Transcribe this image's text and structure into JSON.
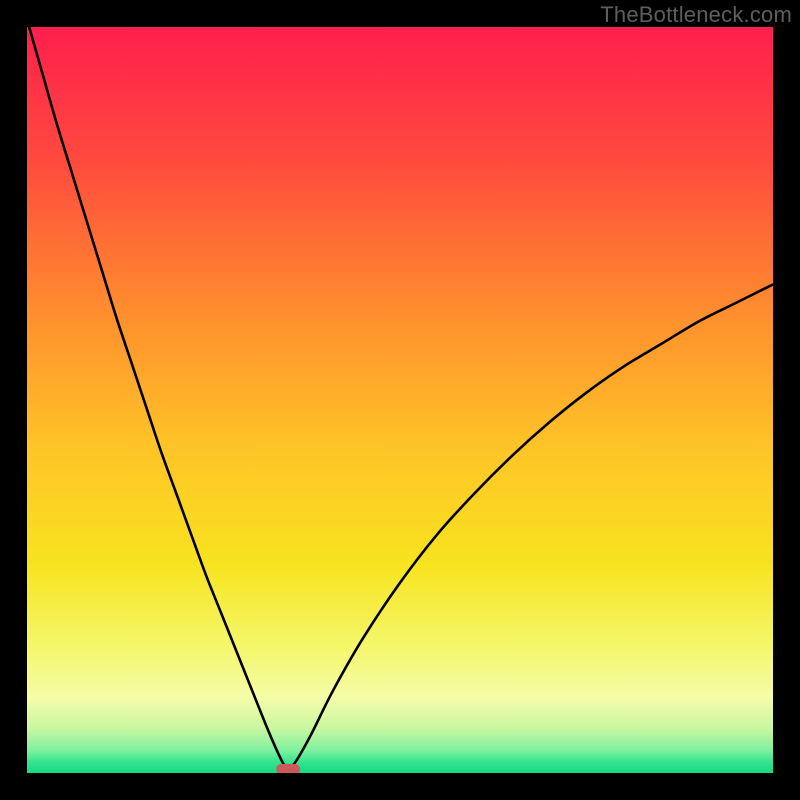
{
  "watermark": "TheBottleneck.com",
  "chart_data": {
    "type": "line",
    "title": "",
    "xlabel": "",
    "ylabel": "",
    "xlim": [
      0,
      100
    ],
    "ylim": [
      0,
      100
    ],
    "grid": false,
    "legend": false,
    "annotations": [],
    "background": {
      "type": "vertical-gradient",
      "stops": [
        {
          "pos": 0.0,
          "color": "#ff1f4d"
        },
        {
          "pos": 0.18,
          "color": "#ff4a3e"
        },
        {
          "pos": 0.38,
          "color": "#ff8d2e"
        },
        {
          "pos": 0.56,
          "color": "#ffc327"
        },
        {
          "pos": 0.72,
          "color": "#f8e31f"
        },
        {
          "pos": 0.83,
          "color": "#f4f76a"
        },
        {
          "pos": 0.9,
          "color": "#f5fca9"
        },
        {
          "pos": 0.94,
          "color": "#c9f7a0"
        },
        {
          "pos": 0.97,
          "color": "#7ef0a0"
        },
        {
          "pos": 0.985,
          "color": "#35e48f"
        },
        {
          "pos": 1.0,
          "color": "#17d983"
        }
      ]
    },
    "series": [
      {
        "name": "bottleneck-curve",
        "color": "#000000",
        "x": [
          0,
          2,
          4,
          6,
          8,
          10,
          12,
          14,
          16,
          18,
          20,
          22,
          24,
          26,
          28,
          30,
          32,
          33.5,
          34.5,
          35,
          36,
          38,
          41,
          45,
          50,
          55,
          60,
          65,
          70,
          75,
          80,
          85,
          90,
          95,
          100
        ],
        "y": [
          101,
          94,
          87,
          80.5,
          74,
          67.5,
          61,
          55,
          49,
          43,
          37.5,
          32,
          26.5,
          21.5,
          16.5,
          11.5,
          6.5,
          3,
          1,
          0.5,
          1.5,
          5,
          11,
          18,
          25.5,
          32,
          37.5,
          42.5,
          47,
          51,
          54.5,
          57.5,
          60.5,
          63,
          65.5
        ]
      }
    ],
    "marker": {
      "name": "minimum-marker",
      "x": 35,
      "y": 0.5,
      "width_pct": 3.2,
      "height_pct": 1.4,
      "color": "#cc5a5a"
    }
  }
}
